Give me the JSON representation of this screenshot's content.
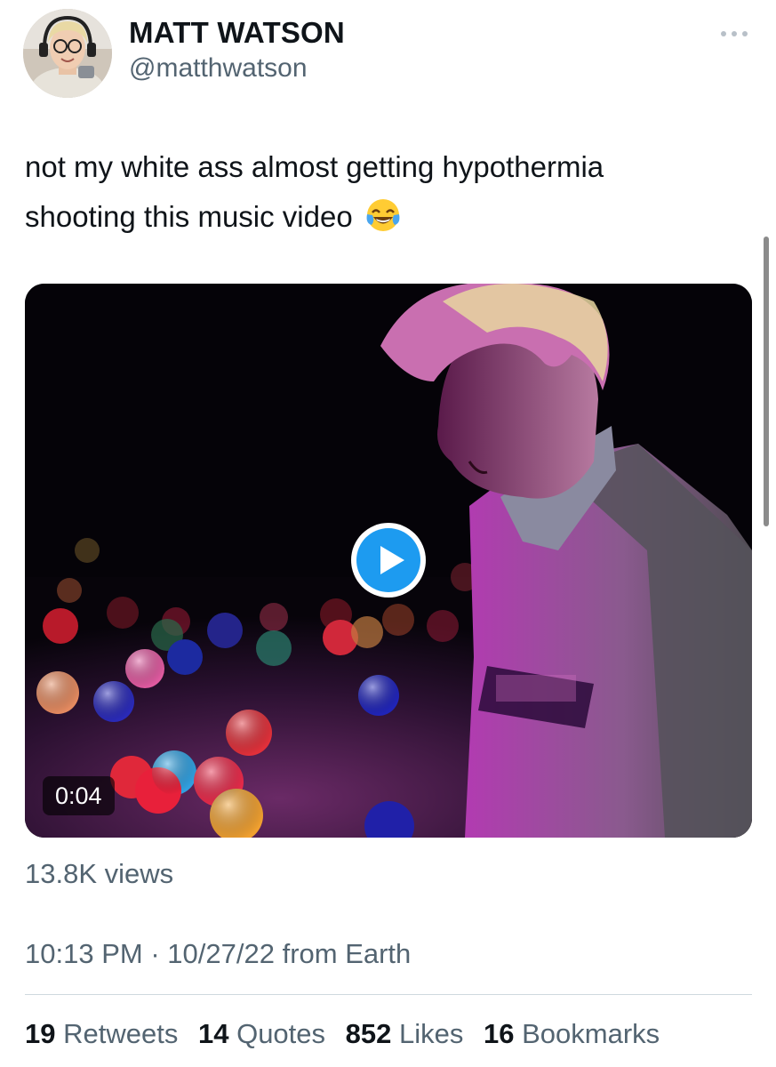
{
  "author": {
    "name": "MATT WATSON",
    "handle": "@matthwatson"
  },
  "tweet": {
    "text_line1": "not my white ass almost getting hypothermia",
    "text_line2": "shooting this music video"
  },
  "video": {
    "duration": "0:04"
  },
  "views": "13.8K views",
  "meta": {
    "time": "10:13 PM",
    "separator": "·",
    "date": "10/27/22",
    "source": "from Earth"
  },
  "stats": [
    {
      "count": "19",
      "label": "Retweets"
    },
    {
      "count": "14",
      "label": "Quotes"
    },
    {
      "count": "852",
      "label": "Likes"
    },
    {
      "count": "16",
      "label": "Bookmarks"
    }
  ],
  "colors": {
    "text": "#0f1419",
    "secondary": "#536471",
    "play_blue": "#1d9bf0",
    "divider": "#cfd9de"
  },
  "icons": {
    "more": "more-horizontal-icon",
    "play": "play-icon",
    "emoji": "face-with-tears-of-joy-emoji"
  }
}
